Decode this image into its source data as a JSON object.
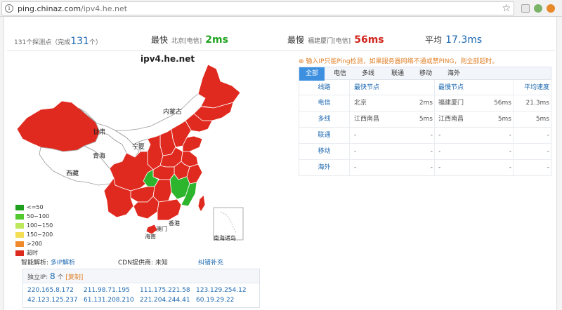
{
  "browser": {
    "url_host": "ping.chinaz.com",
    "url_path": "/ipv4.he.net"
  },
  "stats": {
    "probe_prefix": "131个探测点（完成",
    "probe_done": "131",
    "probe_suffix": "个）",
    "fastest_label": "最快",
    "fastest_location": "北京[电信]",
    "fastest_value": "2ms",
    "slowest_label": "最慢",
    "slowest_location": "福建厦门[电信]",
    "slowest_value": "56ms",
    "average_label": "平均",
    "average_value": "17.3ms"
  },
  "map": {
    "title": "ipv4.he.net",
    "region_labels": [
      "内蒙古",
      "甘肃",
      "青海",
      "西藏",
      "宁夏",
      "香港",
      "澳门",
      "海南",
      "南海诸岛"
    ],
    "colors": {
      "red": "#e02a1f",
      "green": "#2db52d",
      "white": "#ffffff"
    }
  },
  "legend": [
    {
      "label": "<=50",
      "color": "#1e9e1e"
    },
    {
      "label": "50~100",
      "color": "#52c92f"
    },
    {
      "label": "100~150",
      "color": "#bde85c"
    },
    {
      "label": "150~200",
      "color": "#f3de55"
    },
    {
      "label": ">200",
      "color": "#ef8a2c"
    },
    {
      "label": "超时",
      "color": "#dd2a1e"
    }
  ],
  "bottom": {
    "dns_label": "智能解析:",
    "dns_link": "多IP解析",
    "cdn_text": "CDN提供商: 未知",
    "fix_link": "纠错补充"
  },
  "ipbox": {
    "label": "独立IP:",
    "count": "8",
    "count_unit": "个",
    "copy": "[复制]",
    "ips": [
      "220.165.8.172",
      "211.98.71.195",
      "111.175.221.58",
      "123.129.254.12",
      "42.123.125.237",
      "61.131.208.210",
      "221.204.244.41",
      "60.19.29.22"
    ]
  },
  "notice": "输入IP只能Ping检测，如果服务器网络不通或禁PING，则全部超时。",
  "tabs": [
    "全部",
    "电信",
    "多线",
    "联通",
    "移动",
    "海外"
  ],
  "active_tab": "全部",
  "table": {
    "headers": {
      "line": "线路",
      "fastest": "最快节点",
      "slowest": "最慢节点",
      "avg": "平均速度"
    },
    "rows": [
      {
        "line": "电信",
        "fast_node": "北京",
        "fast_ms": "2ms",
        "slow_node": "福建厦门",
        "slow_ms": "56ms",
        "avg": "21.3ms"
      },
      {
        "line": "多线",
        "fast_node": "江西南昌",
        "fast_ms": "5ms",
        "slow_node": "江西南昌",
        "slow_ms": "5ms",
        "avg": "5ms"
      },
      {
        "line": "联通",
        "fast_node": "-",
        "fast_ms": "-",
        "slow_node": "-",
        "slow_ms": "-",
        "avg": "-"
      },
      {
        "line": "移动",
        "fast_node": "-",
        "fast_ms": "-",
        "slow_node": "-",
        "slow_ms": "-",
        "avg": "-"
      },
      {
        "line": "海外",
        "fast_node": "-",
        "fast_ms": "-",
        "slow_node": "-",
        "slow_ms": "-",
        "avg": "-"
      }
    ]
  }
}
